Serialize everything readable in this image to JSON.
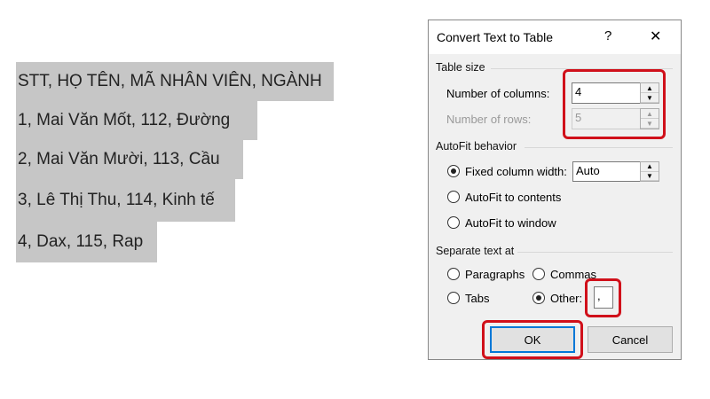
{
  "document": {
    "lines": [
      "STT, HỌ TÊN, MÃ NHÂN VIÊN, NGÀNH",
      "1, Mai Văn Mốt, 112, Đường",
      "2, Mai Văn Mười, 113, Cầu",
      "3, Lê Thị Thu, 114, Kinh tế",
      "4, Dax, 115, Rap"
    ]
  },
  "dialog": {
    "title": "Convert Text to Table",
    "help": "?",
    "close": "✕",
    "table_size": {
      "label": "Table size",
      "columns_label": "Number of columns:",
      "columns_value": "4",
      "rows_label": "Number of rows:",
      "rows_value": "5"
    },
    "autofit": {
      "label": "AutoFit behavior",
      "fixed_label": "Fixed column width:",
      "fixed_value": "Auto",
      "contents_label": "AutoFit to contents",
      "window_label": "AutoFit to window",
      "selected": "fixed"
    },
    "separate": {
      "label": "Separate text at",
      "paragraphs": "Paragraphs",
      "commas": "Commas",
      "tabs": "Tabs",
      "other": "Other:",
      "other_value": ",",
      "selected": "other"
    },
    "ok": "OK",
    "cancel": "Cancel"
  }
}
